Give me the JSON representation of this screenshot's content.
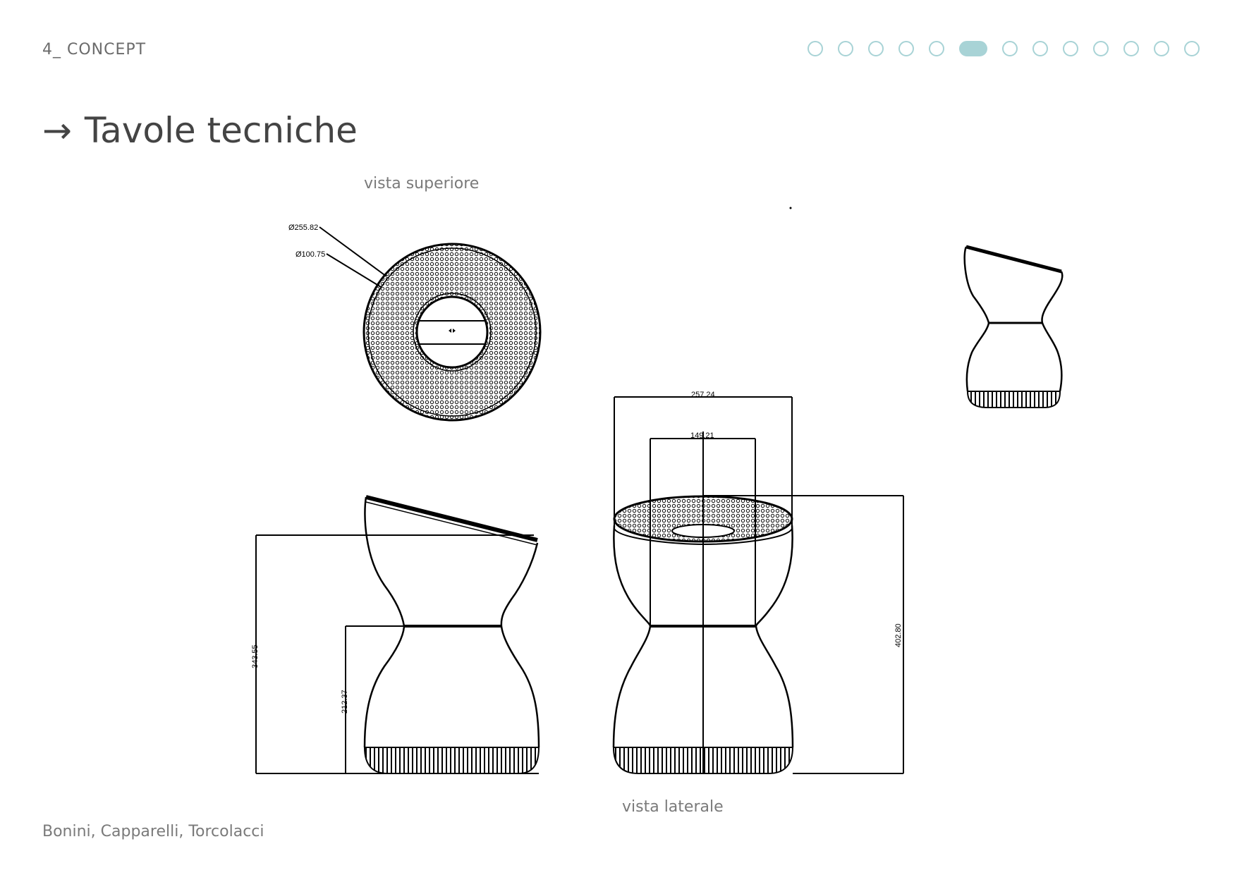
{
  "header": {
    "section_label": "4_ CONCEPT",
    "pager": {
      "total": 13,
      "active_index": 5,
      "accent_color": "#a8d3d6"
    }
  },
  "title": {
    "arrow": "→",
    "text": "Tavole tecniche"
  },
  "views": {
    "top_label": "vista superiore",
    "side_label": "vista laterale"
  },
  "dimensions": {
    "outer_diameter": "Ø255.82",
    "inner_diameter": "Ø100.75",
    "top_width": "257.24",
    "inner_width": "149.21",
    "total_height": "402.80",
    "seat_height": "343.55",
    "waist_height": "212.37"
  },
  "footer": {
    "authors": "Bonini, Capparelli, Torcolacci"
  }
}
